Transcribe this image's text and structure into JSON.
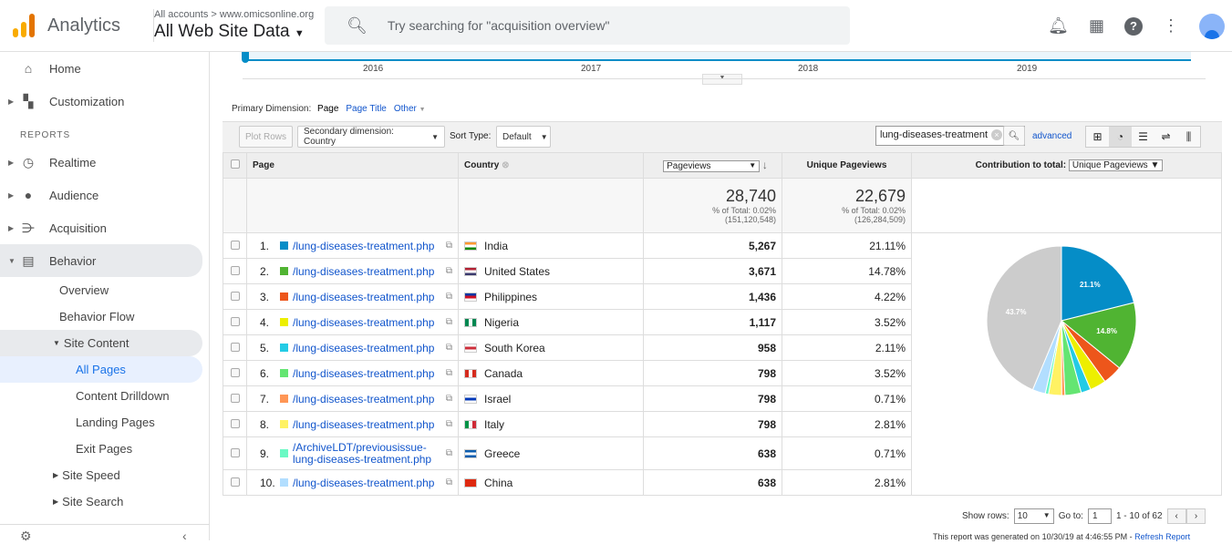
{
  "header": {
    "app_title": "Analytics",
    "account_crumb": "All accounts > www.omicsonline.org",
    "property": "All Web Site Data",
    "search_placeholder": "Try searching for \"acquisition overview\""
  },
  "sidebar": {
    "home": "Home",
    "customization": "Customization",
    "reports_heading": "REPORTS",
    "realtime": "Realtime",
    "audience": "Audience",
    "acquisition": "Acquisition",
    "behavior": "Behavior",
    "overview": "Overview",
    "behavior_flow": "Behavior Flow",
    "site_content": "Site Content",
    "all_pages": "All Pages",
    "content_drilldown": "Content Drilldown",
    "landing_pages": "Landing Pages",
    "exit_pages": "Exit Pages",
    "site_speed": "Site Speed",
    "site_search": "Site Search"
  },
  "timeline": {
    "years": [
      "2016",
      "2017",
      "2018",
      "2019"
    ]
  },
  "dimension": {
    "label": "Primary Dimension:",
    "page": "Page",
    "page_title": "Page Title",
    "other": "Other"
  },
  "toolbar": {
    "plot_rows": "Plot Rows",
    "secondary": "Secondary dimension: Country",
    "sort_label": "Sort Type:",
    "sort_value": "Default",
    "filter_value": "lung-diseases-treatment",
    "advanced": "advanced"
  },
  "table": {
    "headers": {
      "page": "Page",
      "country": "Country",
      "pageviews": "Pageviews",
      "unique": "Unique Pageviews",
      "contribution": "Contribution to total:",
      "contribution_metric": "Unique Pageviews"
    },
    "totals": {
      "pageviews": "28,740",
      "pv_pct": "% of Total: 0.02%",
      "pv_total": "(151,120,548)",
      "unique": "22,679",
      "u_pct": "% of Total: 0.02%",
      "u_total": "(126,284,509)"
    },
    "rows": [
      {
        "n": "1.",
        "page": "/lung-diseases-treatment.php",
        "country": "India",
        "pv": "5,267",
        "upct": "21.11%",
        "color": "#058dc7"
      },
      {
        "n": "2.",
        "page": "/lung-diseases-treatment.php",
        "country": "United States",
        "pv": "3,671",
        "upct": "14.78%",
        "color": "#50b432"
      },
      {
        "n": "3.",
        "page": "/lung-diseases-treatment.php",
        "country": "Philippines",
        "pv": "1,436",
        "upct": "4.22%",
        "color": "#ed561b"
      },
      {
        "n": "4.",
        "page": "/lung-diseases-treatment.php",
        "country": "Nigeria",
        "pv": "1,117",
        "upct": "3.52%",
        "color": "#edef00"
      },
      {
        "n": "5.",
        "page": "/lung-diseases-treatment.php",
        "country": "South Korea",
        "pv": "958",
        "upct": "2.11%",
        "color": "#24cbe5"
      },
      {
        "n": "6.",
        "page": "/lung-diseases-treatment.php",
        "country": "Canada",
        "pv": "798",
        "upct": "3.52%",
        "color": "#64e572"
      },
      {
        "n": "7.",
        "page": "/lung-diseases-treatment.php",
        "country": "Israel",
        "pv": "798",
        "upct": "0.71%",
        "color": "#ff9655"
      },
      {
        "n": "8.",
        "page": "/lung-diseases-treatment.php",
        "country": "Italy",
        "pv": "798",
        "upct": "2.81%",
        "color": "#fff263"
      },
      {
        "n": "9.",
        "page": "/ArchiveLDT/previousissue-lung-diseases-treatment.php",
        "country": "Greece",
        "pv": "638",
        "upct": "0.71%",
        "color": "#6af9c4"
      },
      {
        "n": "10.",
        "page": "/lung-diseases-treatment.php",
        "country": "China",
        "pv": "638",
        "upct": "2.81%",
        "color": "#b2deff"
      }
    ]
  },
  "chart_data": {
    "type": "pie",
    "values": [
      21.11,
      14.78,
      4.22,
      3.52,
      2.11,
      3.52,
      0.71,
      2.81,
      0.71,
      2.81,
      43.7
    ],
    "colors": [
      "#058dc7",
      "#50b432",
      "#ed561b",
      "#edef00",
      "#24cbe5",
      "#64e572",
      "#ff9655",
      "#fff263",
      "#6af9c4",
      "#b2deff",
      "#cccccc"
    ],
    "labels": [
      "21.1%",
      "14.8%",
      "",
      "",
      "",
      "",
      "",
      "",
      "",
      "",
      "43.7%"
    ]
  },
  "footer": {
    "show_rows": "Show rows:",
    "rows_value": "10",
    "goto": "Go to:",
    "goto_value": "1",
    "range": "1 - 10 of 62",
    "generated": "This report was generated on 10/30/19 at 4:46:55 PM - ",
    "refresh": "Refresh Report"
  }
}
